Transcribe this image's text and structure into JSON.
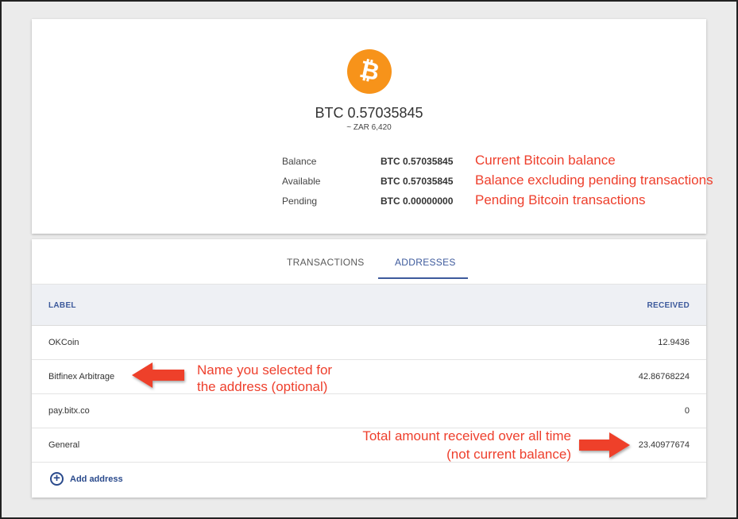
{
  "wallet": {
    "coin_symbol": "₿",
    "main_amount": "BTC 0.57035845",
    "fiat_amount": "~ ZAR 6,420",
    "rows": [
      {
        "label": "Balance",
        "value": "BTC 0.57035845",
        "note": "Current Bitcoin balance"
      },
      {
        "label": "Available",
        "value": "BTC 0.57035845",
        "note": "Balance excluding pending transactions"
      },
      {
        "label": "Pending",
        "value": "BTC 0.00000000",
        "note": "Pending Bitcoin transactions"
      }
    ]
  },
  "tabs": [
    {
      "label": "TRANSACTIONS",
      "active": false
    },
    {
      "label": "ADDRESSES",
      "active": true
    }
  ],
  "table": {
    "columns": [
      "LABEL",
      "RECEIVED"
    ],
    "rows": [
      {
        "label": "OKCoin",
        "received": "12.9436"
      },
      {
        "label": "Bitfinex Arbitrage",
        "received": "42.86768224"
      },
      {
        "label": "pay.bitx.co",
        "received": "0"
      },
      {
        "label": "General",
        "received": "23.40977674"
      }
    ],
    "add_label": "Add address"
  },
  "annotations": {
    "name_note_line1": "Name you selected for",
    "name_note_line2": "the address (optional)",
    "received_note_line1": "Total amount received over all time",
    "received_note_line2": "(not current balance)"
  },
  "colors": {
    "bitcoin_orange": "#f7931a",
    "accent_blue": "#3d5a9c",
    "annotation_red": "#ee3f2c"
  }
}
